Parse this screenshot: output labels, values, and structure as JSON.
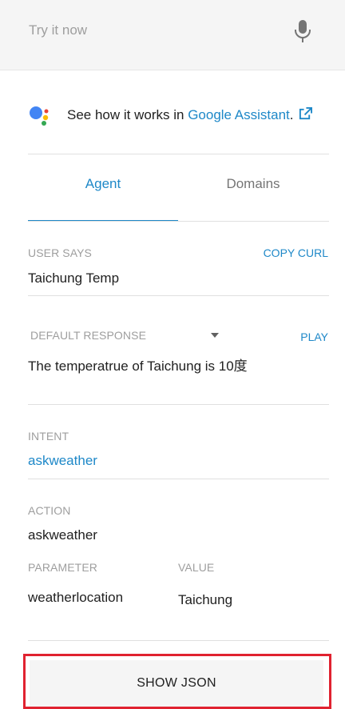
{
  "try_bar": {
    "placeholder": "Try it now",
    "mic_icon": "microphone-icon"
  },
  "assistant": {
    "prefix": "See how it works in ",
    "link": "Google Assistant",
    "suffix": ".",
    "icon": "external-link-icon",
    "logo": "google-assistant-logo"
  },
  "tabs": [
    {
      "label": "Agent",
      "active": true
    },
    {
      "label": "Domains",
      "active": false
    }
  ],
  "user_says": {
    "label": "USER SAYS",
    "value": "Taichung Temp",
    "action": "COPY CURL"
  },
  "response": {
    "label": "DEFAULT RESPONSE",
    "value": "The temperatrue of Taichung is 10度",
    "action": "PLAY"
  },
  "intent": {
    "label": "INTENT",
    "value": "askweather"
  },
  "action": {
    "label": "ACTION",
    "value": "askweather"
  },
  "parameters": {
    "param_header": "PARAMETER",
    "value_header": "VALUE",
    "rows": [
      {
        "name": "weatherlocation",
        "value": "Taichung"
      }
    ]
  },
  "show_json": {
    "label": "SHOW JSON"
  },
  "colors": {
    "accent": "#1e88c8",
    "highlight": "#e02230"
  }
}
